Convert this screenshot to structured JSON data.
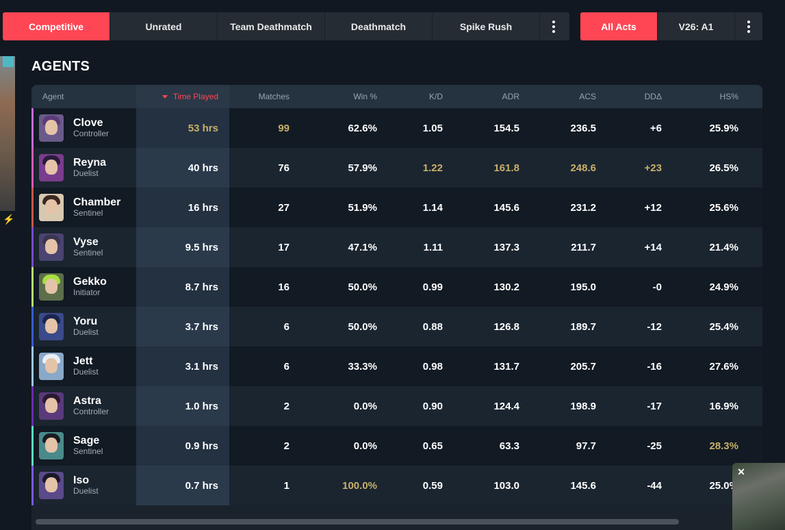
{
  "modes": [
    "Competitive",
    "Unrated",
    "Team Deathmatch",
    "Deathmatch",
    "Spike Rush"
  ],
  "acts": [
    "All Acts",
    "V26: A1"
  ],
  "section_title": "AGENTS",
  "columns": {
    "agent": "Agent",
    "time": "Time Played",
    "matches": "Matches",
    "win": "Win %",
    "kd": "K/D",
    "adr": "ADR",
    "acs": "ACS",
    "dd": "DDΔ",
    "hs": "HS%"
  },
  "colors": {
    "accent_red": "#ff4655",
    "highlight_gold": "#c8b06a",
    "background": "#111821"
  },
  "rows": [
    {
      "name": "Clove",
      "role": "Controller",
      "time": "53 hrs",
      "matches": "99",
      "win": "62.6%",
      "kd": "1.05",
      "adr": "154.5",
      "acs": "236.5",
      "dd": "+6",
      "hs": "25.9%",
      "accent": "#c86ad6",
      "hair": "#5c3a7a",
      "bg": "#6a5a8a"
    },
    {
      "name": "Reyna",
      "role": "Duelist",
      "time": "40 hrs",
      "matches": "76",
      "win": "57.9%",
      "kd": "1.22",
      "adr": "161.8",
      "acs": "248.6",
      "dd": "+23",
      "hs": "26.5%",
      "accent": "#d65ab4",
      "hair": "#2a1b3a",
      "bg": "#7a3c8c"
    },
    {
      "name": "Chamber",
      "role": "Sentinel",
      "time": "16 hrs",
      "matches": "27",
      "win": "51.9%",
      "kd": "1.14",
      "adr": "145.6",
      "acs": "231.2",
      "dd": "+12",
      "hs": "25.6%",
      "accent": "#c4564a",
      "hair": "#3a2a20",
      "bg": "#d8c8b0"
    },
    {
      "name": "Vyse",
      "role": "Sentinel",
      "time": "9.5 hrs",
      "matches": "17",
      "win": "47.1%",
      "kd": "1.11",
      "adr": "137.3",
      "acs": "211.7",
      "dd": "+14",
      "hs": "21.4%",
      "accent": "#7a4ad0",
      "hair": "#3a3550",
      "bg": "#4a4470"
    },
    {
      "name": "Gekko",
      "role": "Initiator",
      "time": "8.7 hrs",
      "matches": "16",
      "win": "50.0%",
      "kd": "0.99",
      "adr": "130.2",
      "acs": "195.0",
      "dd": "-0",
      "hs": "24.9%",
      "accent": "#b6e070",
      "hair": "#a8e040",
      "bg": "#5c6e4a"
    },
    {
      "name": "Yoru",
      "role": "Duelist",
      "time": "3.7 hrs",
      "matches": "6",
      "win": "50.0%",
      "kd": "0.88",
      "adr": "126.8",
      "acs": "189.7",
      "dd": "-12",
      "hs": "25.4%",
      "accent": "#3a5ad0",
      "hair": "#1a2550",
      "bg": "#3a4a8a"
    },
    {
      "name": "Jett",
      "role": "Duelist",
      "time": "3.1 hrs",
      "matches": "6",
      "win": "33.3%",
      "kd": "0.98",
      "adr": "131.7",
      "acs": "205.7",
      "dd": "-16",
      "hs": "27.6%",
      "accent": "#9ac8e8",
      "hair": "#e8eef4",
      "bg": "#8aa8c8"
    },
    {
      "name": "Astra",
      "role": "Controller",
      "time": "1.0 hrs",
      "matches": "2",
      "win": "0.0%",
      "kd": "0.90",
      "adr": "124.4",
      "acs": "198.9",
      "dd": "-17",
      "hs": "16.9%",
      "accent": "#6a2ab0",
      "hair": "#2a1a30",
      "bg": "#5a3a7a"
    },
    {
      "name": "Sage",
      "role": "Sentinel",
      "time": "0.9 hrs",
      "matches": "2",
      "win": "0.0%",
      "kd": "0.65",
      "adr": "63.3",
      "acs": "97.7",
      "dd": "-25",
      "hs": "28.3%",
      "accent": "#5ae0c0",
      "hair": "#1a1a22",
      "bg": "#4a8a8a"
    },
    {
      "name": "Iso",
      "role": "Duelist",
      "time": "0.7 hrs",
      "matches": "1",
      "win": "100.0%",
      "kd": "0.59",
      "adr": "103.0",
      "acs": "145.6",
      "dd": "-44",
      "hs": "25.0%",
      "accent": "#7a5ae0",
      "hair": "#1a1828",
      "bg": "#5a4a8a"
    }
  ],
  "highlights": {
    "0": [
      "time",
      "matches"
    ],
    "1": [
      "kd",
      "adr",
      "acs",
      "dd"
    ],
    "8": [
      "hs"
    ],
    "9": [
      "win"
    ]
  },
  "widget": {
    "close_icon": "close-icon"
  }
}
